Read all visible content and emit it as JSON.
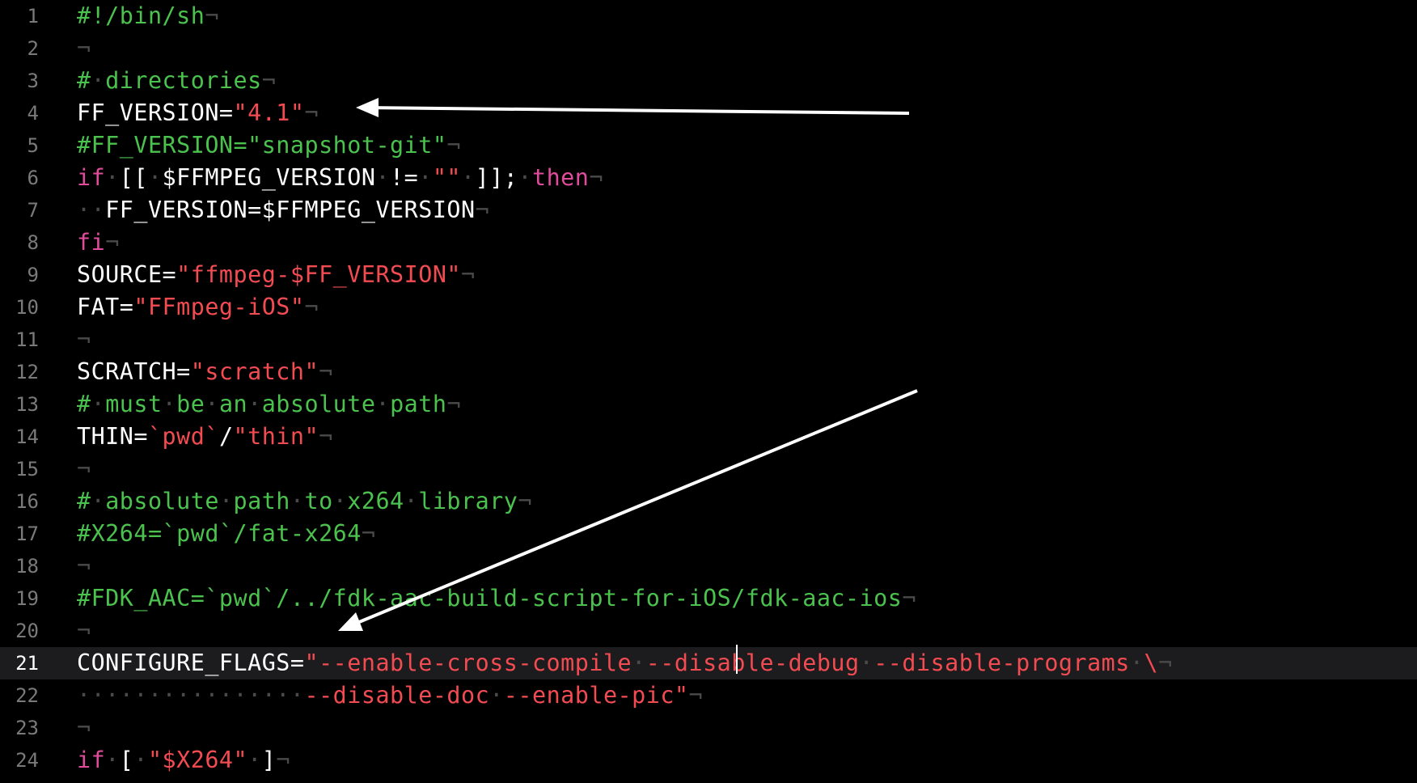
{
  "editor": {
    "current_line": 21,
    "lines": [
      {
        "n": "1",
        "tokens": [
          [
            "#!/bin/sh",
            "c"
          ],
          [
            "¬",
            "i"
          ]
        ]
      },
      {
        "n": "2",
        "tokens": [
          [
            "¬",
            "i"
          ]
        ]
      },
      {
        "n": "3",
        "tokens": [
          [
            "#",
            "c"
          ],
          [
            "·",
            "i"
          ],
          [
            "directories",
            "c"
          ],
          [
            "¬",
            "i"
          ]
        ]
      },
      {
        "n": "4",
        "tokens": [
          [
            "FF_VERSION=",
            "p"
          ],
          [
            "\"4.1\"",
            "s"
          ],
          [
            "¬",
            "i"
          ]
        ]
      },
      {
        "n": "5",
        "tokens": [
          [
            "#FF_VERSION=\"snapshot-git\"",
            "c"
          ],
          [
            "¬",
            "i"
          ]
        ]
      },
      {
        "n": "6",
        "tokens": [
          [
            "if",
            "k"
          ],
          [
            "·",
            "i"
          ],
          [
            "[[",
            "p"
          ],
          [
            "·",
            "i"
          ],
          [
            "$FFMPEG_VERSION",
            "p"
          ],
          [
            "·",
            "i"
          ],
          [
            "!=",
            "p"
          ],
          [
            "·",
            "i"
          ],
          [
            "\"\"",
            "s"
          ],
          [
            "·",
            "i"
          ],
          [
            "]];",
            "p"
          ],
          [
            "·",
            "i"
          ],
          [
            "then",
            "k"
          ],
          [
            "¬",
            "i"
          ]
        ]
      },
      {
        "n": "7",
        "tokens": [
          [
            "··",
            "i"
          ],
          [
            "FF_VERSION=$FFMPEG_VERSION",
            "p"
          ],
          [
            "¬",
            "i"
          ]
        ]
      },
      {
        "n": "8",
        "tokens": [
          [
            "fi",
            "k"
          ],
          [
            "¬",
            "i"
          ]
        ]
      },
      {
        "n": "9",
        "tokens": [
          [
            "SOURCE=",
            "p"
          ],
          [
            "\"ffmpeg-$FF_VERSION\"",
            "s"
          ],
          [
            "¬",
            "i"
          ]
        ]
      },
      {
        "n": "10",
        "tokens": [
          [
            "FAT=",
            "p"
          ],
          [
            "\"FFmpeg-iOS\"",
            "s"
          ],
          [
            "¬",
            "i"
          ]
        ]
      },
      {
        "n": "11",
        "tokens": [
          [
            "¬",
            "i"
          ]
        ]
      },
      {
        "n": "12",
        "tokens": [
          [
            "SCRATCH=",
            "p"
          ],
          [
            "\"scratch\"",
            "s"
          ],
          [
            "¬",
            "i"
          ]
        ]
      },
      {
        "n": "13",
        "tokens": [
          [
            "#",
            "c"
          ],
          [
            "·",
            "i"
          ],
          [
            "must",
            "c"
          ],
          [
            "·",
            "i"
          ],
          [
            "be",
            "c"
          ],
          [
            "·",
            "i"
          ],
          [
            "an",
            "c"
          ],
          [
            "·",
            "i"
          ],
          [
            "absolute",
            "c"
          ],
          [
            "·",
            "i"
          ],
          [
            "path",
            "c"
          ],
          [
            "¬",
            "i"
          ]
        ]
      },
      {
        "n": "14",
        "tokens": [
          [
            "THIN=",
            "p"
          ],
          [
            "`pwd`",
            "s"
          ],
          [
            "/",
            "p"
          ],
          [
            "\"thin\"",
            "s"
          ],
          [
            "¬",
            "i"
          ]
        ]
      },
      {
        "n": "15",
        "tokens": [
          [
            "¬",
            "i"
          ]
        ]
      },
      {
        "n": "16",
        "tokens": [
          [
            "#",
            "c"
          ],
          [
            "·",
            "i"
          ],
          [
            "absolute",
            "c"
          ],
          [
            "·",
            "i"
          ],
          [
            "path",
            "c"
          ],
          [
            "·",
            "i"
          ],
          [
            "to",
            "c"
          ],
          [
            "·",
            "i"
          ],
          [
            "x264",
            "c"
          ],
          [
            "·",
            "i"
          ],
          [
            "library",
            "c"
          ],
          [
            "¬",
            "i"
          ]
        ]
      },
      {
        "n": "17",
        "tokens": [
          [
            "#X264=`pwd`/fat-x264",
            "c"
          ],
          [
            "¬",
            "i"
          ]
        ]
      },
      {
        "n": "18",
        "tokens": [
          [
            "¬",
            "i"
          ]
        ]
      },
      {
        "n": "19",
        "tokens": [
          [
            "#FDK_AAC=`pwd`/../fdk-aac-build-script-for-iOS/fdk-aac-ios",
            "c"
          ],
          [
            "¬",
            "i"
          ]
        ]
      },
      {
        "n": "20",
        "tokens": [
          [
            "¬",
            "i"
          ]
        ]
      },
      {
        "n": "21",
        "tokens": [
          [
            "CONFIGURE_FLAGS=",
            "p"
          ],
          [
            "\"--enable-cross-compile",
            "s"
          ],
          [
            "·",
            "i"
          ],
          [
            "--disable-debug",
            "s"
          ],
          [
            "·",
            "i"
          ],
          [
            "--disable-programs",
            "s"
          ],
          [
            "·",
            "i"
          ],
          [
            "\\",
            "s"
          ],
          [
            "¬",
            "i"
          ]
        ]
      },
      {
        "n": "22",
        "tokens": [
          [
            "················",
            "i"
          ],
          [
            "--disable-doc",
            "s"
          ],
          [
            "·",
            "i"
          ],
          [
            "--enable-pic\"",
            "s"
          ],
          [
            "¬",
            "i"
          ]
        ]
      },
      {
        "n": "23",
        "tokens": [
          [
            "¬",
            "i"
          ]
        ]
      },
      {
        "n": "24",
        "tokens": [
          [
            "if",
            "k"
          ],
          [
            "·",
            "i"
          ],
          [
            "[",
            "p"
          ],
          [
            "·",
            "i"
          ],
          [
            "\"$X264\"",
            "s"
          ],
          [
            "·",
            "i"
          ],
          [
            "]",
            "p"
          ],
          [
            "¬",
            "i"
          ]
        ]
      }
    ]
  },
  "colors": {
    "background": "#000000",
    "current_line_bg": "#1c1c1e",
    "plain": "#ffffff",
    "comment": "#4cc24e",
    "string": "#f24b52",
    "keyword": "#e04c9c",
    "invisible": "#4a4a4a",
    "line_number": "#7a7a7a",
    "annotation_arrow": "#ffffff"
  },
  "annotations": [
    {
      "name": "arrow-to-ff-version",
      "points_to_line": 4
    },
    {
      "name": "arrow-to-configure-flags",
      "points_to_line": 21
    }
  ]
}
